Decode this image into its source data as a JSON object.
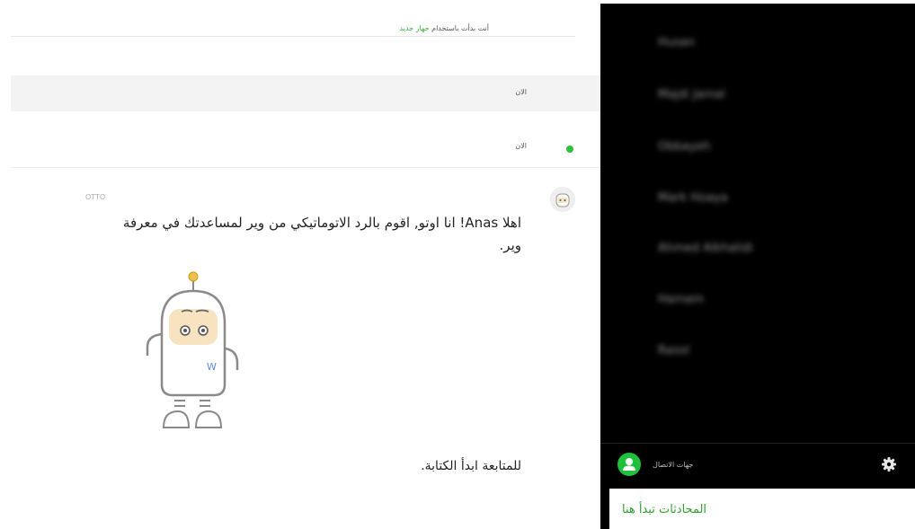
{
  "chat": {
    "notice": "أنت بدأت باستخدام",
    "notice_link": "جهاز جديد",
    "time_row1": "الان",
    "time_row2": "الان",
    "sender_name": "OTTO",
    "message_lines": [
      "اهلا Anas! انا اوتو, اقوم بالرد الاتوماتيكي من وير لمساعدتك في معرفة",
      "وير."
    ],
    "cta": "للمتابعة ابدأ الكتابة."
  },
  "sidebar": {
    "contacts": [
      "Husan",
      "Majdi Jamal",
      "Obbayeh",
      "Mark Hoaya",
      "Ahmed Alkhalidi",
      "Hamam",
      "Rasol"
    ],
    "footer_label": "جهات الاتصال",
    "start_card": "المحادثات تبدأ هنا"
  },
  "colors": {
    "accent_green": "#2fbf3c",
    "sidebar_bg": "#000000",
    "link_green": "#38b538"
  },
  "icons": {
    "gear": "gear-icon",
    "user": "user-icon",
    "status": "online-dot-icon"
  }
}
